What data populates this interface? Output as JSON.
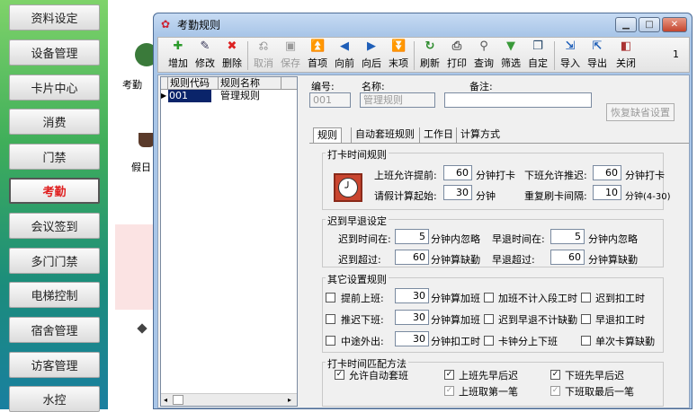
{
  "sidebar": {
    "items": [
      {
        "label": "资料设定",
        "active": false
      },
      {
        "label": "设备管理",
        "active": false
      },
      {
        "label": "卡片中心",
        "active": false
      },
      {
        "label": "消费",
        "active": false
      },
      {
        "label": "门禁",
        "active": false
      },
      {
        "label": "考勤",
        "active": true
      },
      {
        "label": "会议签到",
        "active": false
      },
      {
        "label": "多门门禁",
        "active": false
      },
      {
        "label": "电梯控制",
        "active": false
      },
      {
        "label": "宿舍管理",
        "active": false
      },
      {
        "label": "访客管理",
        "active": false
      },
      {
        "label": "水控",
        "active": false
      }
    ]
  },
  "background": {
    "icon1_label": "考勤",
    "icon2_label": "假日"
  },
  "window": {
    "title": "考勤规则",
    "page_indicator": "1"
  },
  "toolbar": {
    "add": "增加",
    "edit": "修改",
    "delete": "删除",
    "cancel": "取消",
    "save": "保存",
    "first": "首项",
    "prev": "向前",
    "next": "向后",
    "last": "末项",
    "refresh": "刷新",
    "print": "打印",
    "query": "查询",
    "filter": "筛选",
    "custom": "自定",
    "import": "导入",
    "export": "导出",
    "close": "关闭"
  },
  "list": {
    "col1": "规则代码",
    "col2": "规则名称",
    "rows": [
      {
        "code": "001",
        "name": "管理规则"
      }
    ]
  },
  "form": {
    "code_label": "编号:",
    "code_value": "001",
    "name_label": "名称:",
    "name_value": "管理规则",
    "note_label": "备注:",
    "note_value": "",
    "restore_button": "恢复缺省设置"
  },
  "tabs": [
    "规则",
    "自动套班规则",
    "工作日",
    "计算方式"
  ],
  "punch_rules": {
    "title": "打卡时间规则",
    "early_allow_label": "上班允许提前:",
    "early_allow_value": "60",
    "early_allow_unit": "分钟打卡",
    "late_allow_label": "下班允许推迟:",
    "late_allow_value": "60",
    "late_allow_unit": "分钟打卡",
    "leave_start_label": "请假计算起始:",
    "leave_start_value": "30",
    "leave_start_unit": "分钟",
    "repeat_label": "重复刷卡间隔:",
    "repeat_value": "10",
    "repeat_unit": "分钟(4-30)"
  },
  "late_early": {
    "title": "迟到早退设定",
    "late_in_label": "迟到时间在:",
    "late_in_value": "5",
    "late_in_unit": "分钟内忽略",
    "early_in_label": "早退时间在:",
    "early_in_value": "5",
    "early_in_unit": "分钟内忽略",
    "late_over_label": "迟到超过:",
    "late_over_value": "60",
    "late_over_unit": "分钟算缺勤",
    "early_over_label": "早退超过:",
    "early_over_value": "60",
    "early_over_unit": "分钟算缺勤"
  },
  "other_rules": {
    "title": "其它设置规则",
    "advance_label": "提前上班:",
    "advance_value": "30",
    "advance_unit": "分钟算加班",
    "ot_no_section": "加班不计入段工时",
    "late_deduct": "迟到扣工时",
    "delay_label": "推迟下班:",
    "delay_value": "30",
    "delay_unit": "分钟算加班",
    "late_early_no_absent": "迟到早退不计缺勤",
    "early_deduct": "早退扣工时",
    "outing_label": "中途外出:",
    "outing_value": "30",
    "outing_unit": "分钟扣工时",
    "card_split": "卡钟分上下班",
    "single_absent": "单次卡算缺勤"
  },
  "match": {
    "title": "打卡时间匹配方法",
    "auto_shift": "允许自动套班",
    "on_early_late": "上班先早后迟",
    "off_early_late": "下班先早后迟",
    "on_first": "上班取第一笔",
    "off_last": "下班取最后一笔"
  }
}
